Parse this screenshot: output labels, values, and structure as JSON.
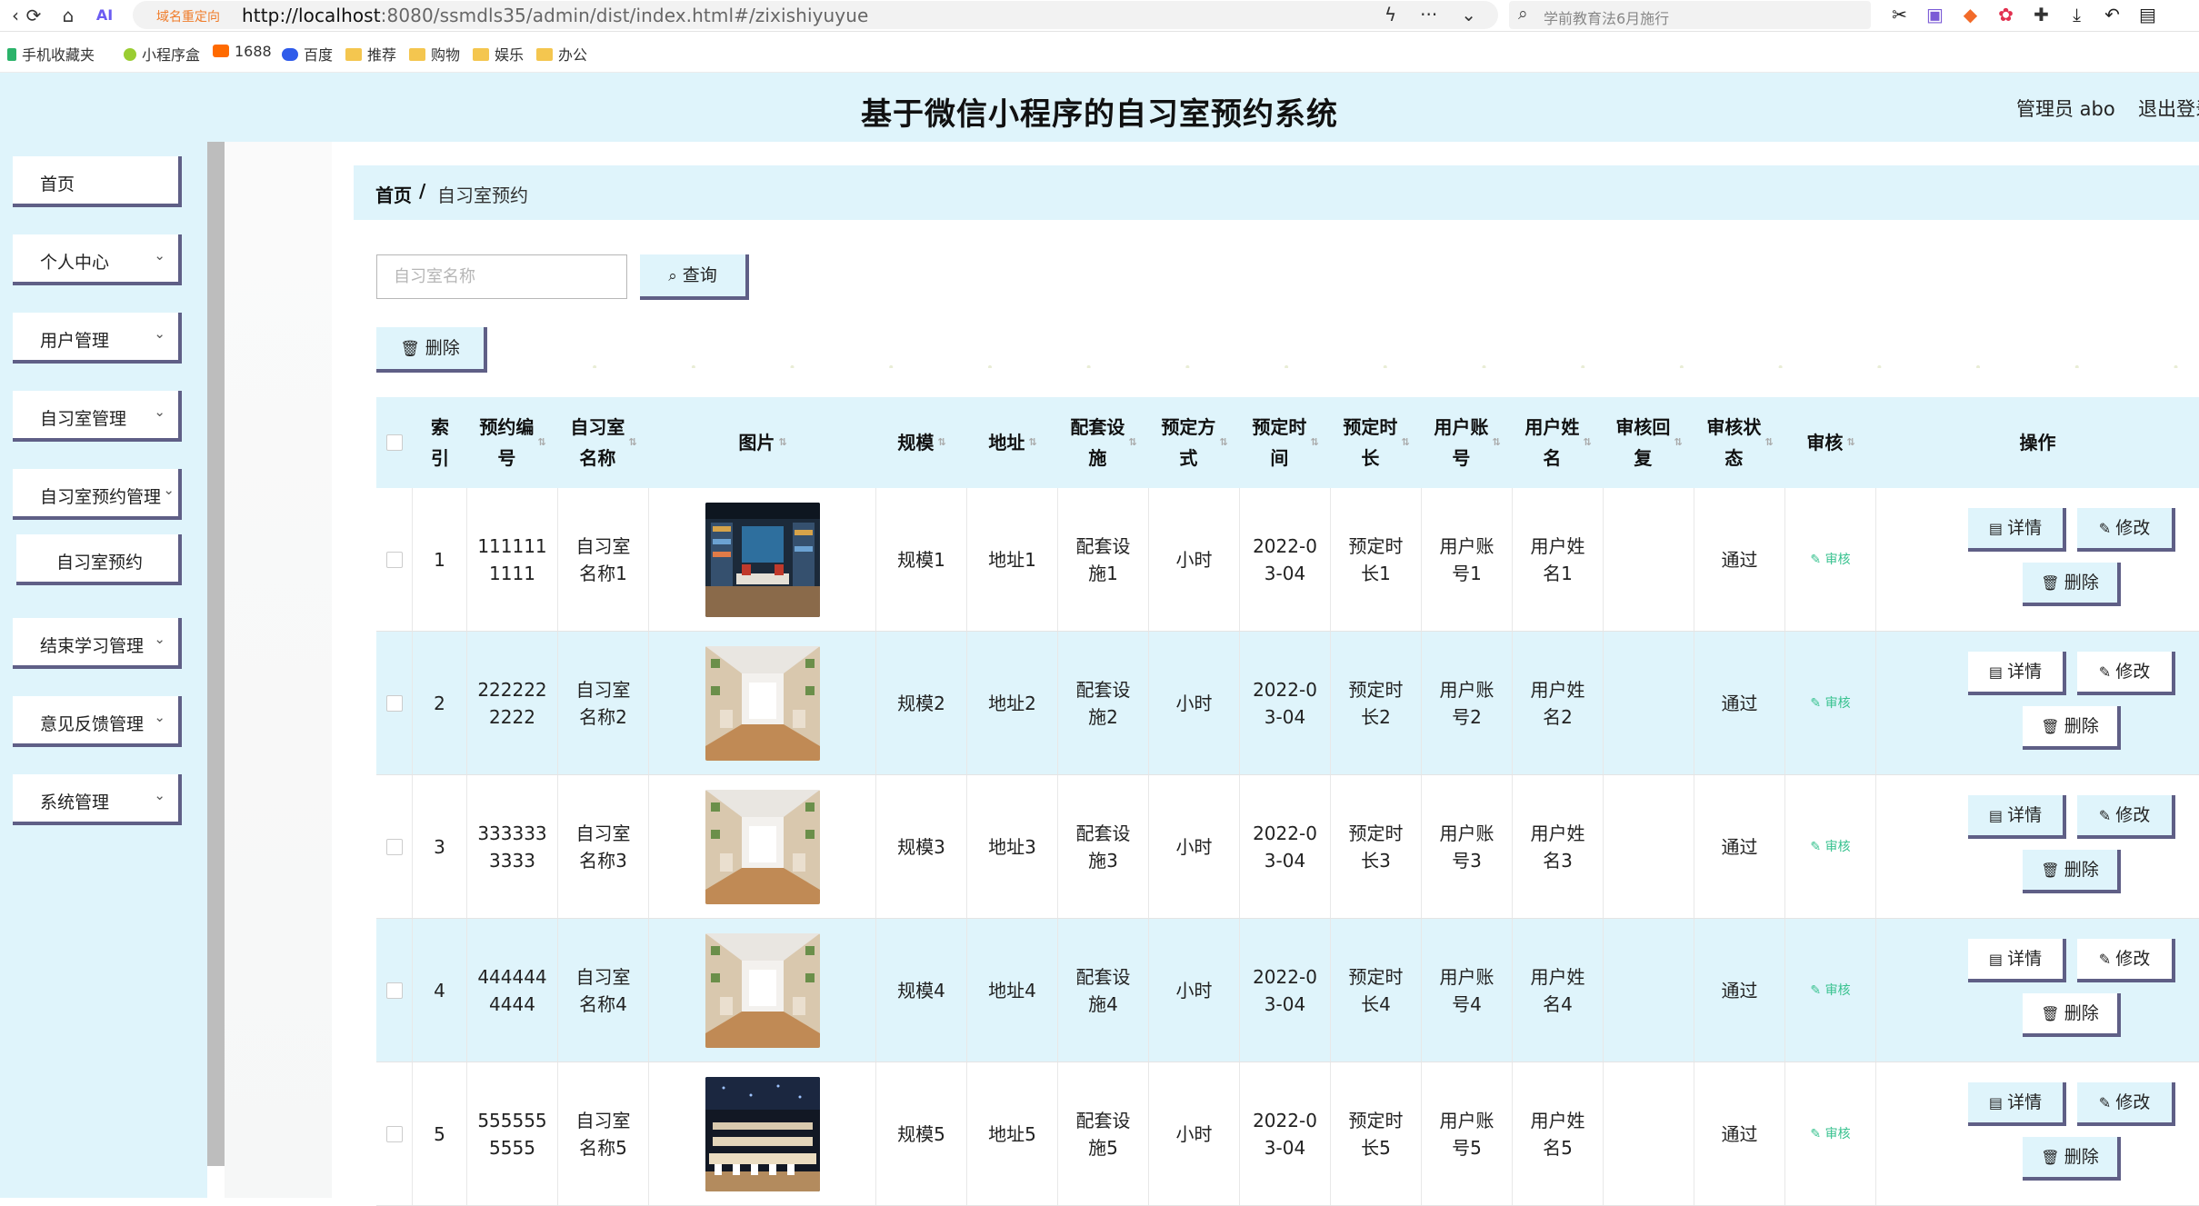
{
  "browser": {
    "redirect_label": "域名重定向",
    "url_host": "http://localhost",
    "url_rest": ":8080/ssmdls35/admin/dist/index.html#/zixishiyuyue",
    "search_placeholder": "学前教育法6月施行",
    "bookmarks": [
      "手机收藏夹",
      "小程序盒",
      "1688",
      "百度",
      "推荐",
      "购物",
      "娱乐",
      "办公"
    ]
  },
  "header": {
    "title": "基于微信小程序的自习室预约系统",
    "admin_label": "管理员 abo",
    "logout": "退出登录"
  },
  "sidebar": {
    "items": [
      {
        "label": "首页",
        "has_arrow": false
      },
      {
        "label": "个人中心",
        "has_arrow": true
      },
      {
        "label": "用户管理",
        "has_arrow": true
      },
      {
        "label": "自习室管理",
        "has_arrow": true
      },
      {
        "label": "自习室预约管理",
        "has_arrow": true
      },
      {
        "label": "自习室预约",
        "has_arrow": false,
        "sub": true
      },
      {
        "label": "结束学习管理",
        "has_arrow": true
      },
      {
        "label": "意见反馈管理",
        "has_arrow": true
      },
      {
        "label": "系统管理",
        "has_arrow": true
      }
    ]
  },
  "breadcrumb": {
    "home": "首页",
    "separator": "/",
    "current": "自习室预约"
  },
  "search": {
    "placeholder": "自习室名称",
    "query_label": "查询"
  },
  "toolbar": {
    "delete_label": "删除"
  },
  "table": {
    "columns": [
      "索引",
      "预约编号",
      "自习室名称",
      "图片",
      "规模",
      "地址",
      "配套设施",
      "预定方式",
      "预定时间",
      "预定时长",
      "用户账号",
      "用户姓名",
      "审核回复",
      "审核状态",
      "审核",
      "操作"
    ],
    "column_display": [
      "索\n引",
      "预约编\n号",
      "自习室\n名称",
      "图片",
      "规模",
      "地址",
      "配套设\n施",
      "预定方\n式",
      "预定时\n间",
      "预定时\n长",
      "用户账\n号",
      "用户姓\n名",
      "审核回\n复",
      "审核状\n态",
      "审核",
      "操作"
    ],
    "rows": [
      {
        "index": "1",
        "booking_no": "111111\n1111",
        "room_name": "自习室\n名称1",
        "scale": "规模1",
        "address": "地址1",
        "facilities": "配套设\n施1",
        "method": "小时",
        "time": "2022-0\n3-04",
        "duration": "预定时\n长1",
        "account": "用户账\n号1",
        "user_name": "用户姓\n名1",
        "reply": "",
        "status": "通过",
        "audit": "审核",
        "photo": "library"
      },
      {
        "index": "2",
        "booking_no": "222222\n2222",
        "room_name": "自习室\n名称2",
        "scale": "规模2",
        "address": "地址2",
        "facilities": "配套设\n施2",
        "method": "小时",
        "time": "2022-0\n3-04",
        "duration": "预定时\n长2",
        "account": "用户账\n号2",
        "user_name": "用户姓\n名2",
        "reply": "",
        "status": "通过",
        "audit": "审核",
        "photo": "booths"
      },
      {
        "index": "3",
        "booking_no": "333333\n3333",
        "room_name": "自习室\n名称3",
        "scale": "规模3",
        "address": "地址3",
        "facilities": "配套设\n施3",
        "method": "小时",
        "time": "2022-0\n3-04",
        "duration": "预定时\n长3",
        "account": "用户账\n号3",
        "user_name": "用户姓\n名3",
        "reply": "",
        "status": "通过",
        "audit": "审核",
        "photo": "booths"
      },
      {
        "index": "4",
        "booking_no": "444444\n4444",
        "room_name": "自习室\n名称4",
        "scale": "规模4",
        "address": "地址4",
        "facilities": "配套设\n施4",
        "method": "小时",
        "time": "2022-0\n3-04",
        "duration": "预定时\n长4",
        "account": "用户账\n号4",
        "user_name": "用户姓\n名4",
        "reply": "",
        "status": "通过",
        "audit": "审核",
        "photo": "booths"
      },
      {
        "index": "5",
        "booking_no": "555555\n5555",
        "room_name": "自习室\n名称5",
        "scale": "规模5",
        "address": "地址5",
        "facilities": "配套设\n施5",
        "method": "小时",
        "time": "2022-0\n3-04",
        "duration": "预定时\n长5",
        "account": "用户账\n号5",
        "user_name": "用户姓\n名5",
        "reply": "",
        "status": "通过",
        "audit": "审核",
        "photo": "dark-hall"
      }
    ],
    "row_actions": {
      "detail": "详情",
      "edit": "修改",
      "delete": "删除"
    }
  },
  "colors": {
    "accent_bg": "#dff4fb",
    "button_shadow": "#5f5f86",
    "audit_green": "#38c28f"
  }
}
